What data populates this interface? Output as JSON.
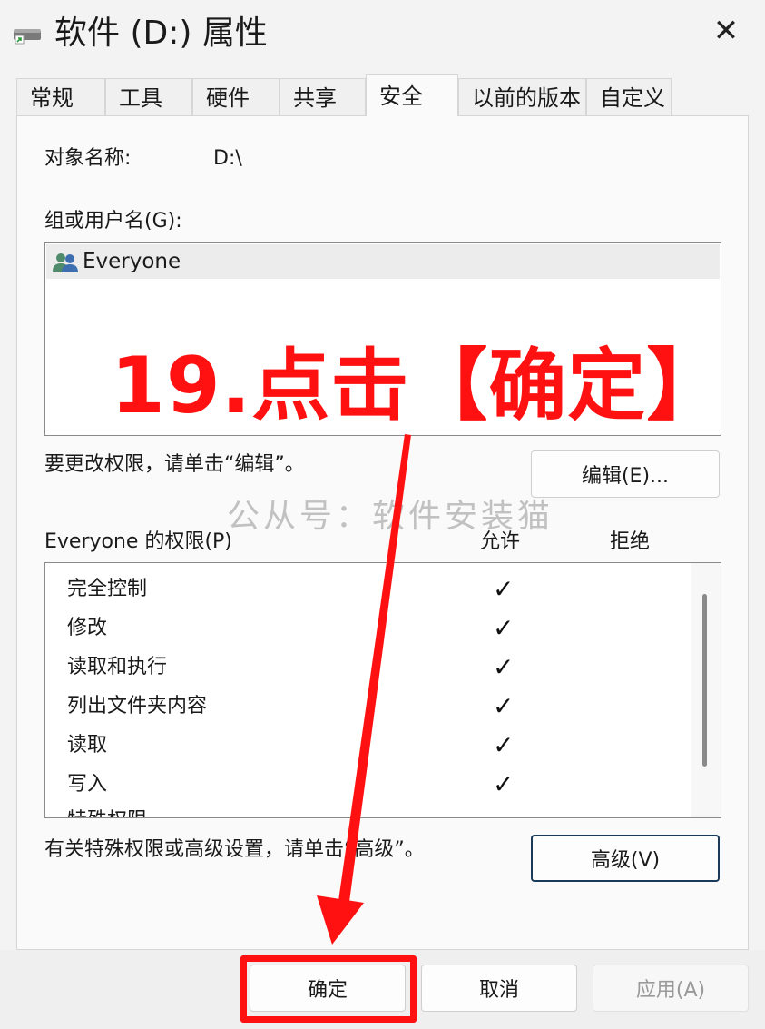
{
  "window": {
    "title": "软件 (D:) 属性",
    "close_symbol": "✕"
  },
  "tabs": [
    {
      "label": "常规"
    },
    {
      "label": "工具"
    },
    {
      "label": "硬件"
    },
    {
      "label": "共享"
    },
    {
      "label": "安全",
      "active": true
    },
    {
      "label": "以前的版本"
    },
    {
      "label": "自定义"
    }
  ],
  "security": {
    "object_name_label": "对象名称:",
    "object_name_value": "D:\\",
    "groups_label": "组或用户名(G):",
    "groups": [
      {
        "name": "Everyone",
        "icon": "users-icon",
        "selected": true
      }
    ],
    "edit_hint": "要更改权限，请单击“编辑”。",
    "edit_button": "编辑(E)...",
    "permissions_label": "Everyone 的权限(P)",
    "allow_header": "允许",
    "deny_header": "拒绝",
    "permissions": [
      {
        "name": "完全控制",
        "allow": "✓",
        "deny": ""
      },
      {
        "name": "修改",
        "allow": "✓",
        "deny": ""
      },
      {
        "name": "读取和执行",
        "allow": "✓",
        "deny": ""
      },
      {
        "name": "列出文件夹内容",
        "allow": "✓",
        "deny": ""
      },
      {
        "name": "读取",
        "allow": "✓",
        "deny": ""
      },
      {
        "name": "写入",
        "allow": "✓",
        "deny": ""
      },
      {
        "name": "特殊权限",
        "allow": "",
        "deny": ""
      }
    ],
    "advanced_hint": "有关特殊权限或高级设置，请单击“高级”。",
    "advanced_button": "高级(V)"
  },
  "footer": {
    "ok_button": "确定",
    "cancel_button": "取消",
    "apply_button": "应用(A)"
  },
  "overlay": {
    "annotation": "19.点击【确定】",
    "watermark": "公从号：软件安装猫",
    "arrow_color": "#ff1111"
  }
}
